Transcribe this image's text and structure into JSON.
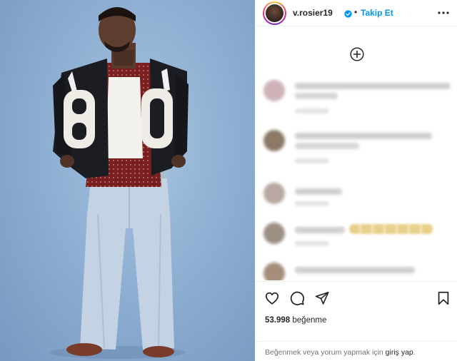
{
  "post": {
    "username": "v.rosier19",
    "separator": "•",
    "follow_label": "Takip Et",
    "photo_jacket_number": "80"
  },
  "comments": [
    {
      "blurred": true
    },
    {
      "blurred": true
    },
    {
      "blurred": true
    },
    {
      "blurred": true
    },
    {
      "blurred": true
    }
  ],
  "likes": {
    "count": "53.998",
    "label": "beğenme"
  },
  "footer": {
    "prefix": "Beğenmek veya yorum yapmak için",
    "login_link": "giriş yap",
    "suffix": "."
  },
  "colors": {
    "accent": "#0095f6",
    "verified": "#0095f6",
    "text": "#262626",
    "muted": "#737373",
    "background_photo": "#8fb0d3"
  },
  "icons": [
    "verified-badge-icon",
    "more-options-icon",
    "add-comment-icon",
    "heart-icon",
    "comment-icon",
    "share-icon",
    "bookmark-icon"
  ]
}
